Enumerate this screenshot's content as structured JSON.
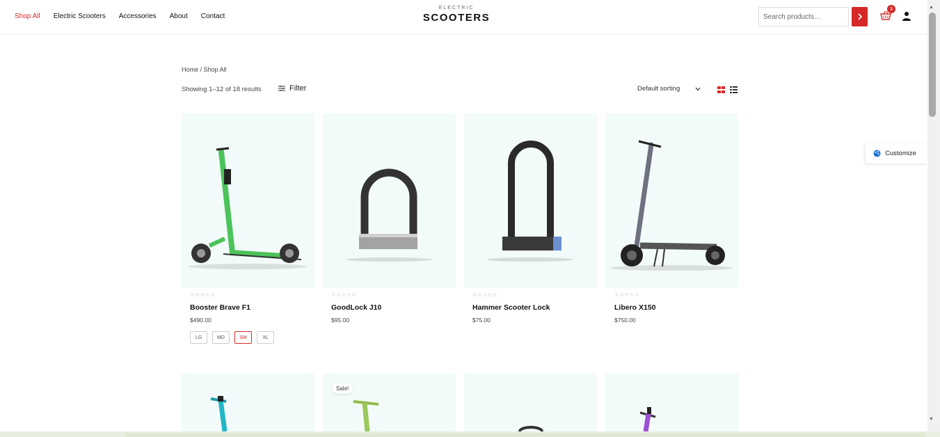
{
  "nav": {
    "items": [
      {
        "label": "Shop All",
        "active": true
      },
      {
        "label": "Electric Scooters",
        "active": false
      },
      {
        "label": "Accessories",
        "active": false
      },
      {
        "label": "About",
        "active": false
      },
      {
        "label": "Contact",
        "active": false
      }
    ]
  },
  "logo": {
    "top": "ELECTRIC",
    "main": "SCOOTERS"
  },
  "search": {
    "placeholder": "Search products…"
  },
  "cart": {
    "count": "3"
  },
  "breadcrumb": "Home / Shop All",
  "toolbar": {
    "results": "Showing 1–12 of 18 results",
    "filter_label": "Filter",
    "sorting_label": "Default sorting"
  },
  "products": [
    {
      "title": "Booster Brave F1",
      "price": "$490.00",
      "stars": "☆☆☆☆☆",
      "sizes": [
        "LG",
        "MD",
        "SM",
        "XL"
      ],
      "selected_size": "SM"
    },
    {
      "title": "GoodLock J10",
      "price": "$95.00",
      "stars": "☆☆☆☆☆"
    },
    {
      "title": "Hammer Scooter Lock",
      "price": "$75.00",
      "stars": "☆☆☆☆☆"
    },
    {
      "title": "Libero X150",
      "price": "$750.00",
      "stars": "☆☆☆☆☆"
    }
  ],
  "second_row": {
    "sale_label": "Sale!"
  },
  "customize": {
    "label": "Customize"
  },
  "colors": {
    "accent": "#d62828",
    "card_bg": "#f2fbf9",
    "scooter_green": "#4cc35a"
  }
}
